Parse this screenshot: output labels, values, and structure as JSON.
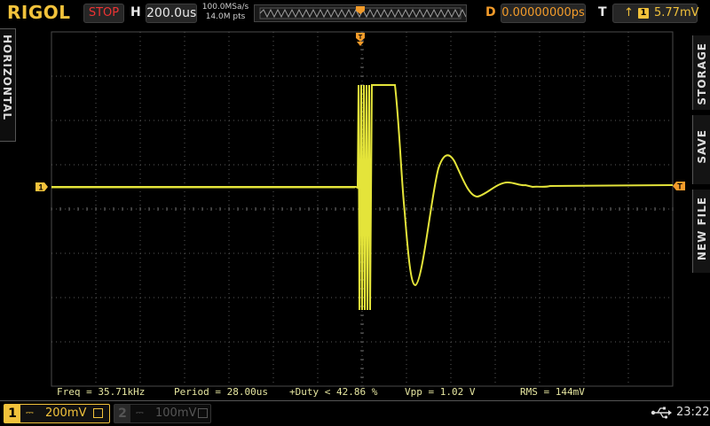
{
  "brand": "RIGOL",
  "header": {
    "run_status": "STOP",
    "horizontal_label": "H",
    "timebase": "200.0us",
    "sample_rate": "100.0MSa/s",
    "memory_depth": "14.0M pts",
    "delay_label": "D",
    "delay": "0.00000000ps",
    "trigger_label": "T",
    "trigger_edge": "rising",
    "trigger_channel": "1",
    "trigger_level": "5.77mV"
  },
  "left_tab": {
    "label": "HORIZONTAL"
  },
  "right_menu": {
    "items": [
      {
        "label": "STORAGE"
      },
      {
        "label": "SAVE"
      },
      {
        "label": "NEW FILE"
      }
    ]
  },
  "markers": {
    "channel1": "1",
    "trigger_level": "T"
  },
  "measurements": {
    "freq": "Freq = 35.71kHz",
    "period": "Period = 28.00us",
    "duty": "+Duty < 42.86 %",
    "vpp": "Vpp = 1.02 V",
    "rms": "RMS = 144mV"
  },
  "channels": [
    {
      "num": "1",
      "scale": "200mV",
      "active": true
    },
    {
      "num": "2",
      "scale": "100mV",
      "active": false
    }
  ],
  "clock": "23:22",
  "colors": {
    "ch1": "#f2c23b",
    "trigger": "#f29b2a",
    "grid": "#5a5a5a",
    "stop": "#ee3333"
  }
}
